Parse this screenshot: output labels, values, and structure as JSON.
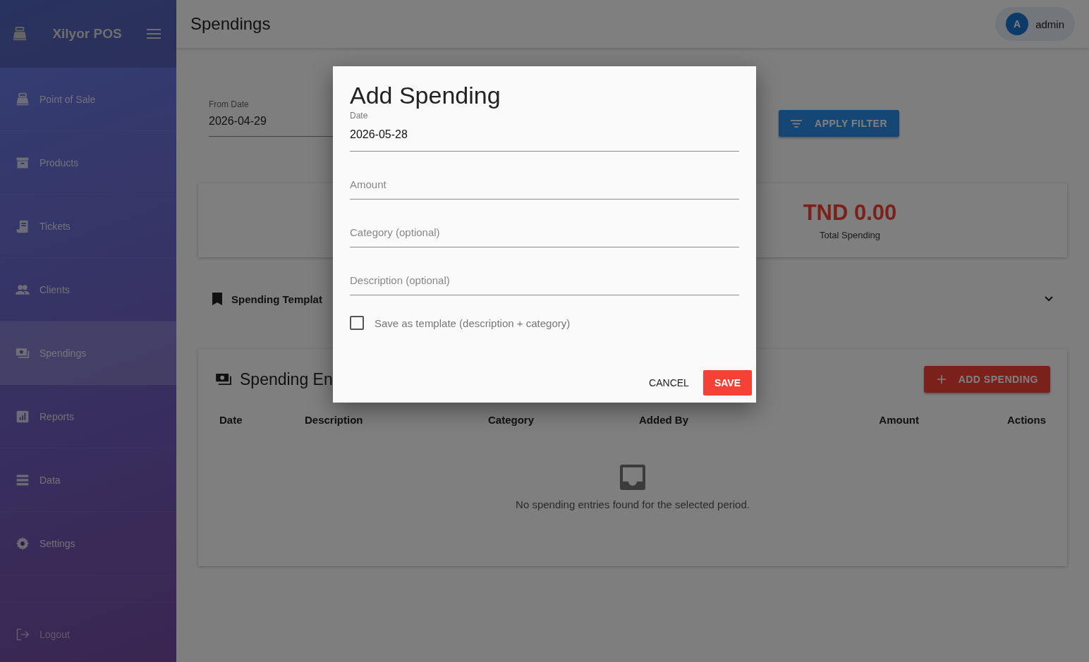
{
  "app": {
    "name": "Xilyor POS"
  },
  "sidebar": {
    "items": [
      {
        "label": "Point of Sale",
        "selected": false
      },
      {
        "label": "Products",
        "selected": false
      },
      {
        "label": "Tickets",
        "selected": false
      },
      {
        "label": "Clients",
        "selected": false
      },
      {
        "label": "Spendings",
        "selected": true
      },
      {
        "label": "Reports",
        "selected": false
      },
      {
        "label": "Data",
        "selected": false
      },
      {
        "label": "Settings",
        "selected": false
      }
    ],
    "logout": "Logout"
  },
  "header": {
    "title": "Spendings",
    "user": {
      "initial": "A",
      "name": "admin"
    }
  },
  "filter": {
    "from_label": "From Date",
    "from_value": "2026-04-29",
    "apply_label": "APPLY FILTER"
  },
  "summary": {
    "total": "TND 0.00",
    "label": "Total Spending"
  },
  "templates": {
    "title": "Spending Templat",
    "expanded": false
  },
  "entries": {
    "title": "Spending En",
    "add_label": "ADD SPENDING",
    "columns": [
      "Date",
      "Description",
      "Category",
      "Added By",
      "Amount",
      "Actions"
    ],
    "empty": "No spending entries found for the selected period."
  },
  "dialog": {
    "title": "Add Spending",
    "fields": [
      {
        "label": "Date",
        "value": "2026-05-28"
      },
      {
        "placeholder": "Amount"
      },
      {
        "placeholder": "Category (optional)"
      },
      {
        "placeholder": "Description (optional)"
      }
    ],
    "save_template": {
      "label": "Save as template (description + category)",
      "checked": false
    },
    "cancel": "CANCEL",
    "save": "SAVE"
  }
}
